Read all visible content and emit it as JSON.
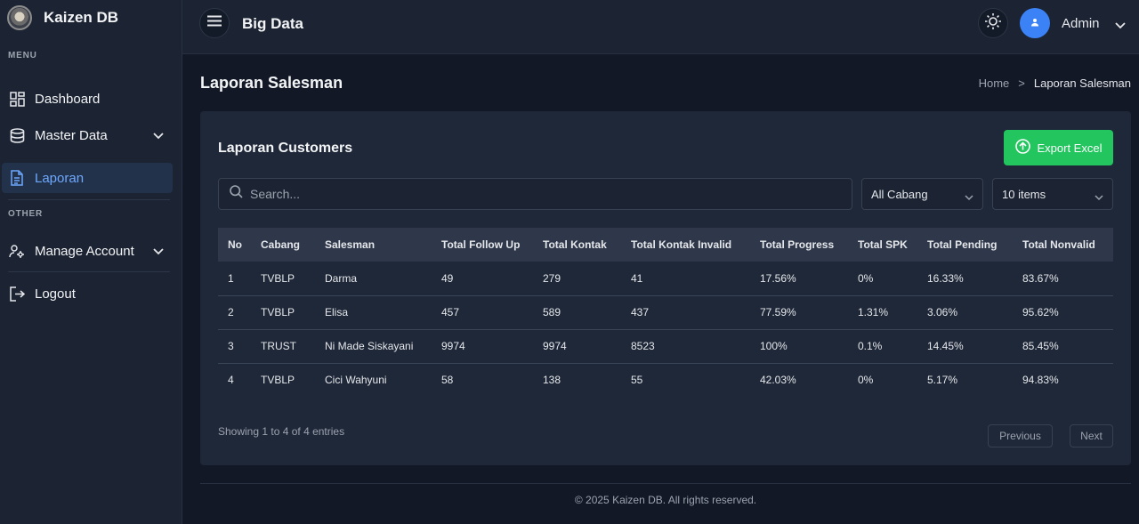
{
  "brand": {
    "name": "Kaizen DB"
  },
  "sidebar": {
    "menu_title": "MENU",
    "other_title": "OTHER",
    "items": [
      {
        "label": "Dashboard"
      },
      {
        "label": "Master Data"
      },
      {
        "label": "Laporan"
      },
      {
        "label": "Manage Account"
      },
      {
        "label": "Logout"
      }
    ]
  },
  "topbar": {
    "title": "Big Data",
    "user": "Admin"
  },
  "page": {
    "title": "Laporan Salesman",
    "breadcrumb": {
      "home": "Home",
      "separator": ">",
      "current": "Laporan Salesman"
    }
  },
  "card": {
    "title": "Laporan Customers",
    "export_label": "Export Excel",
    "search_placeholder": "Search...",
    "cabang_selected": "All Cabang",
    "items_selected": "10 items",
    "columns": [
      "No",
      "Cabang",
      "Salesman",
      "Total Follow Up",
      "Total Kontak",
      "Total Kontak Invalid",
      "Total Progress",
      "Total SPK",
      "Total Pending",
      "Total Nonvalid"
    ],
    "rows": [
      [
        "1",
        "TVBLP",
        "Darma",
        "49",
        "279",
        "41",
        "17.56%",
        "0%",
        "16.33%",
        "83.67%"
      ],
      [
        "2",
        "TVBLP",
        "Elisa",
        "457",
        "589",
        "437",
        "77.59%",
        "1.31%",
        "3.06%",
        "95.62%"
      ],
      [
        "3",
        "TRUST",
        "Ni Made Siskayani",
        "9974",
        "9974",
        "8523",
        "100%",
        "0.1%",
        "14.45%",
        "85.45%"
      ],
      [
        "4",
        "TVBLP",
        "Cici Wahyuni",
        "58",
        "138",
        "55",
        "42.03%",
        "0%",
        "5.17%",
        "94.83%"
      ]
    ],
    "showing": "Showing 1 to 4 of 4 entries",
    "prev_label": "Previous",
    "next_label": "Next"
  },
  "footer": {
    "text": "© 2025 Kaizen DB. All rights reserved."
  },
  "colors": {
    "accent": "#3b82f6",
    "export": "#22c55e",
    "active_text": "#6ea8fe"
  },
  "icons": {
    "dashboard": "grid-icon",
    "master": "database-icon",
    "laporan": "document-icon",
    "manage": "users-gear-icon",
    "logout": "logout-icon",
    "menu": "hamburger-icon",
    "theme": "sun-icon",
    "search": "search-icon",
    "export": "upload-circle-icon"
  }
}
